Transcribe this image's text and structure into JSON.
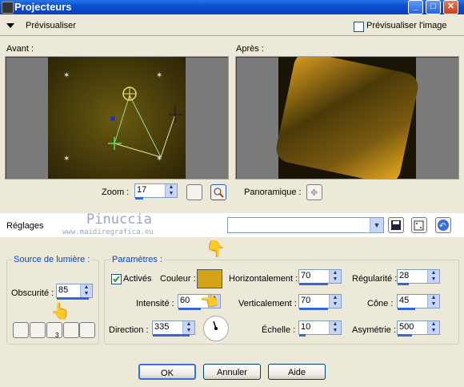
{
  "window": {
    "title": "Projecteurs"
  },
  "preview": {
    "label": "Prévisualiser",
    "checkbox_label": "Prévisualiser l'image",
    "before_label": "Avant :",
    "after_label": "Après :"
  },
  "zoom": {
    "label": "Zoom :",
    "value": "17",
    "pan_label": "Panoramique :"
  },
  "settings": {
    "label": "Réglages",
    "watermark_line1": "Pinuccia",
    "watermark_line2": "www.maidiregrafica.eu"
  },
  "light_source": {
    "group_label": "Source de lumière :",
    "darkness_label": "Obscurité :",
    "darkness_value": "85",
    "tooltip": "3"
  },
  "params": {
    "group_label": "Paramètres :",
    "active_label": "Activés",
    "active_checked": true,
    "color_label": "Couleur :",
    "color_value": "#D4A418",
    "intensity_label": "Intensité :",
    "intensity_value": "60",
    "direction_label": "Direction :",
    "direction_value": "335",
    "horizontal_label": "Horizontalement :",
    "horizontal_value": "70",
    "vertical_label": "Verticalement :",
    "vertical_value": "70",
    "scale_label": "Échelle :",
    "scale_value": "10",
    "regularity_label": "Régularité :",
    "regularity_value": "28",
    "cone_label": "Cône :",
    "cone_value": "45",
    "asymmetry_label": "Asymétrie :",
    "asymmetry_value": "500"
  },
  "buttons": {
    "ok": "OK",
    "cancel": "Annuler",
    "help": "Aide"
  },
  "colors": {
    "accent": "#3068D8",
    "swatch": "#D4A418"
  }
}
